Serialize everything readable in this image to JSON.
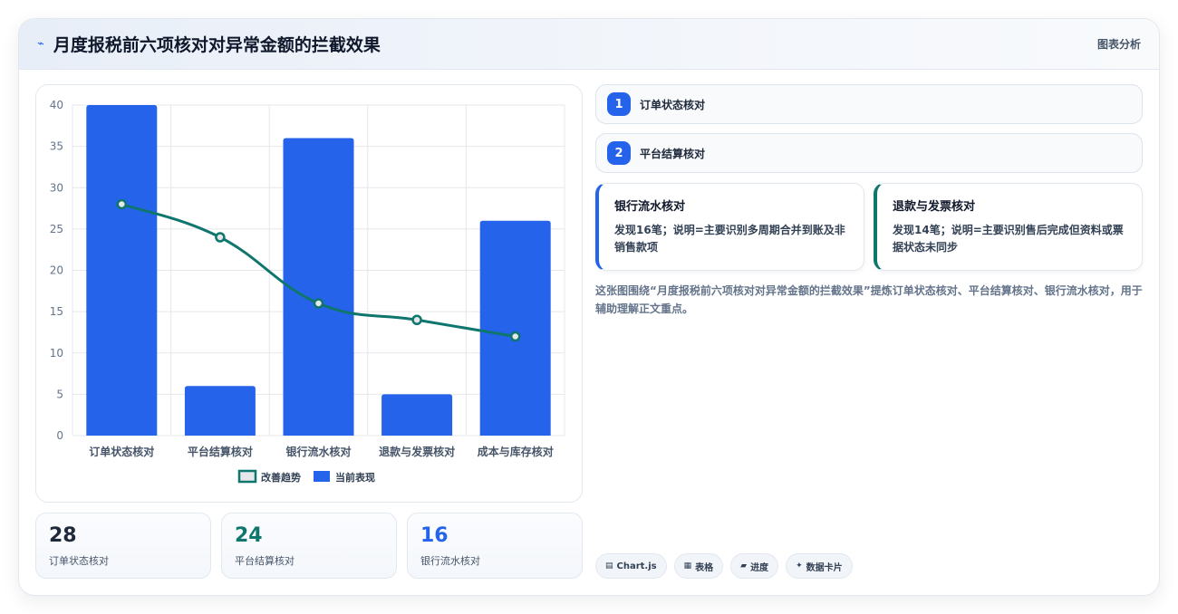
{
  "header": {
    "icon": "line-chart-icon",
    "title": "月度报税前六项核对对异常金额的拦截效果",
    "tag": "图表分析"
  },
  "chart_data": {
    "type": "bar",
    "categories": [
      "订单状态核对",
      "平台结算核对",
      "银行流水核对",
      "退款与发票核对",
      "成本与库存核对"
    ],
    "series": [
      {
        "name": "当前表现",
        "type": "bar",
        "color": "#2563eb",
        "values": [
          40,
          6,
          36,
          5,
          26
        ]
      },
      {
        "name": "改善趋势",
        "type": "line",
        "color": "#0f766e",
        "values": [
          28,
          24,
          16,
          14,
          12
        ]
      }
    ],
    "ylim": [
      0,
      40
    ],
    "yticks": [
      0,
      5,
      10,
      15,
      20,
      25,
      30,
      35,
      40
    ],
    "grid": true,
    "legend": "bottom",
    "legend_order": [
      "改善趋势",
      "当前表现"
    ]
  },
  "stats": [
    {
      "value": "28",
      "label": "订单状态核对",
      "color": "#1e293b"
    },
    {
      "value": "24",
      "label": "平台结算核对",
      "color": "#0f766e"
    },
    {
      "value": "16",
      "label": "银行流水核对",
      "color": "#2563eb"
    }
  ],
  "items": [
    {
      "index": "1",
      "label": "订单状态核对"
    },
    {
      "index": "2",
      "label": "平台结算核对"
    }
  ],
  "details": [
    {
      "title": "银行流水核对",
      "text": "发现16笔；说明=主要识别多周期合并到账及非销售款项",
      "accent": "#2563eb"
    },
    {
      "title": "退款与发票核对",
      "text": "发现14笔；说明=主要识别售后完成但资料或票据状态未同步",
      "accent": "#0f766e"
    }
  ],
  "description": "这张图围绕“月度报税前六项核对对异常金额的拦截效果”提炼订单状态核对、平台结算核对、银行流水核对，用于辅助理解正文重点。",
  "chips": [
    {
      "icon": "chart-icon",
      "glyph": "▤",
      "label": "Chart.js"
    },
    {
      "icon": "table-icon",
      "glyph": "▦",
      "label": "表格"
    },
    {
      "icon": "progress-icon",
      "glyph": "▰",
      "label": "进度"
    },
    {
      "icon": "sparkle-icon",
      "glyph": "✦",
      "label": "数据卡片"
    }
  ]
}
